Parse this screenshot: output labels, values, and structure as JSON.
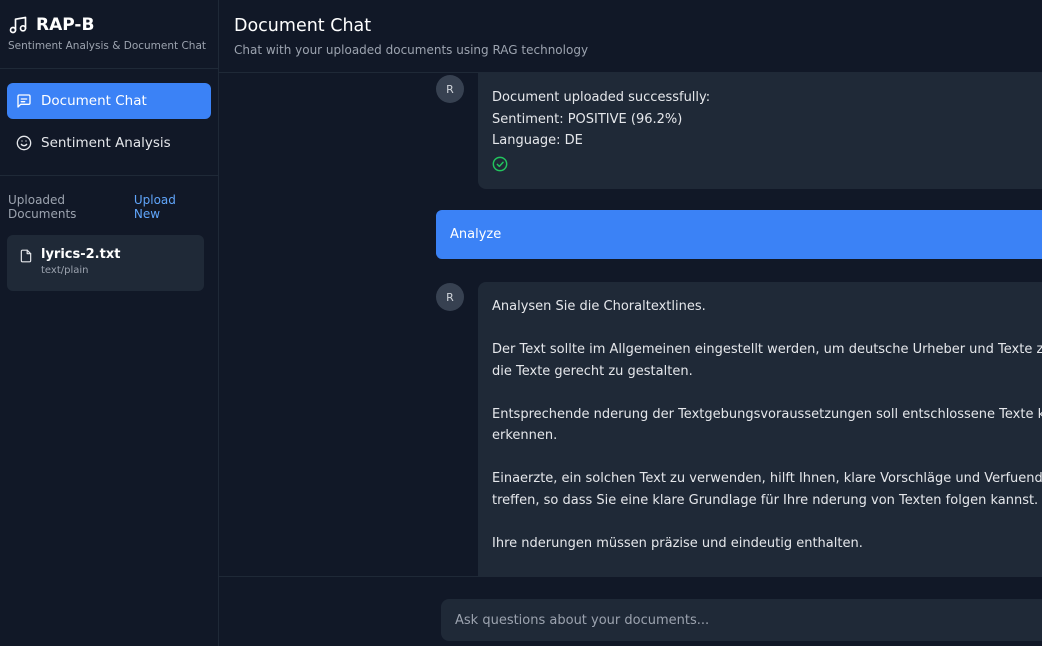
{
  "brand": {
    "title": "RAP-B",
    "subtitle": "Sentiment Analysis & Document Chat",
    "icon": "music-note-icon"
  },
  "nav": [
    {
      "label": "Document Chat",
      "icon": "chat-bubble-icon",
      "active": true
    },
    {
      "label": "Sentiment Analysis",
      "icon": "smiley-icon",
      "active": false
    }
  ],
  "documents": {
    "title": "Uploaded Documents",
    "upload_label": "Upload New",
    "items": [
      {
        "name": "lyrics-2.txt",
        "type": "text/plain",
        "icon": "file-icon"
      }
    ]
  },
  "header": {
    "title": "Document Chat",
    "subtitle": "Chat with your uploaded documents using RAG technology"
  },
  "messages": [
    {
      "role": "assistant",
      "avatar": "R",
      "lines": [
        "Document uploaded successfully:",
        "Sentiment: POSITIVE (96.2%)",
        "Language: DE"
      ],
      "status_icon": "check-circle-icon"
    },
    {
      "role": "user",
      "text": "Analyze"
    },
    {
      "role": "assistant",
      "avatar": "R",
      "paragraphs": [
        [
          "Analysen Sie die Choraltextlines."
        ],
        [
          "Der Text sollte im Allgemeinen eingestellt werden, um deutsche Urheber und Texte zu fin",
          "die Texte gerecht zu gestalten."
        ],
        [
          "Entsprechende nderung der Textgebungsvoraussetzungen soll entschlossene Texte klarer",
          "erkennen."
        ],
        [
          "Einaerzte, ein solchen Text zu verwenden, hilft Ihnen, klare Vorschläge und Verfuendung z",
          "treffen, so dass Sie eine klare Grundlage für Ihre nderung von Texten folgen kannst."
        ],
        [
          "Ihre nderungen müssen präzise und eindeutig enthalten."
        ]
      ]
    }
  ],
  "input": {
    "placeholder": "Ask questions about your documents..."
  },
  "colors": {
    "accent": "#3b82f6",
    "background": "#111827",
    "panel": "#1f2937",
    "success": "#22c55e",
    "link": "#60a5fa"
  }
}
